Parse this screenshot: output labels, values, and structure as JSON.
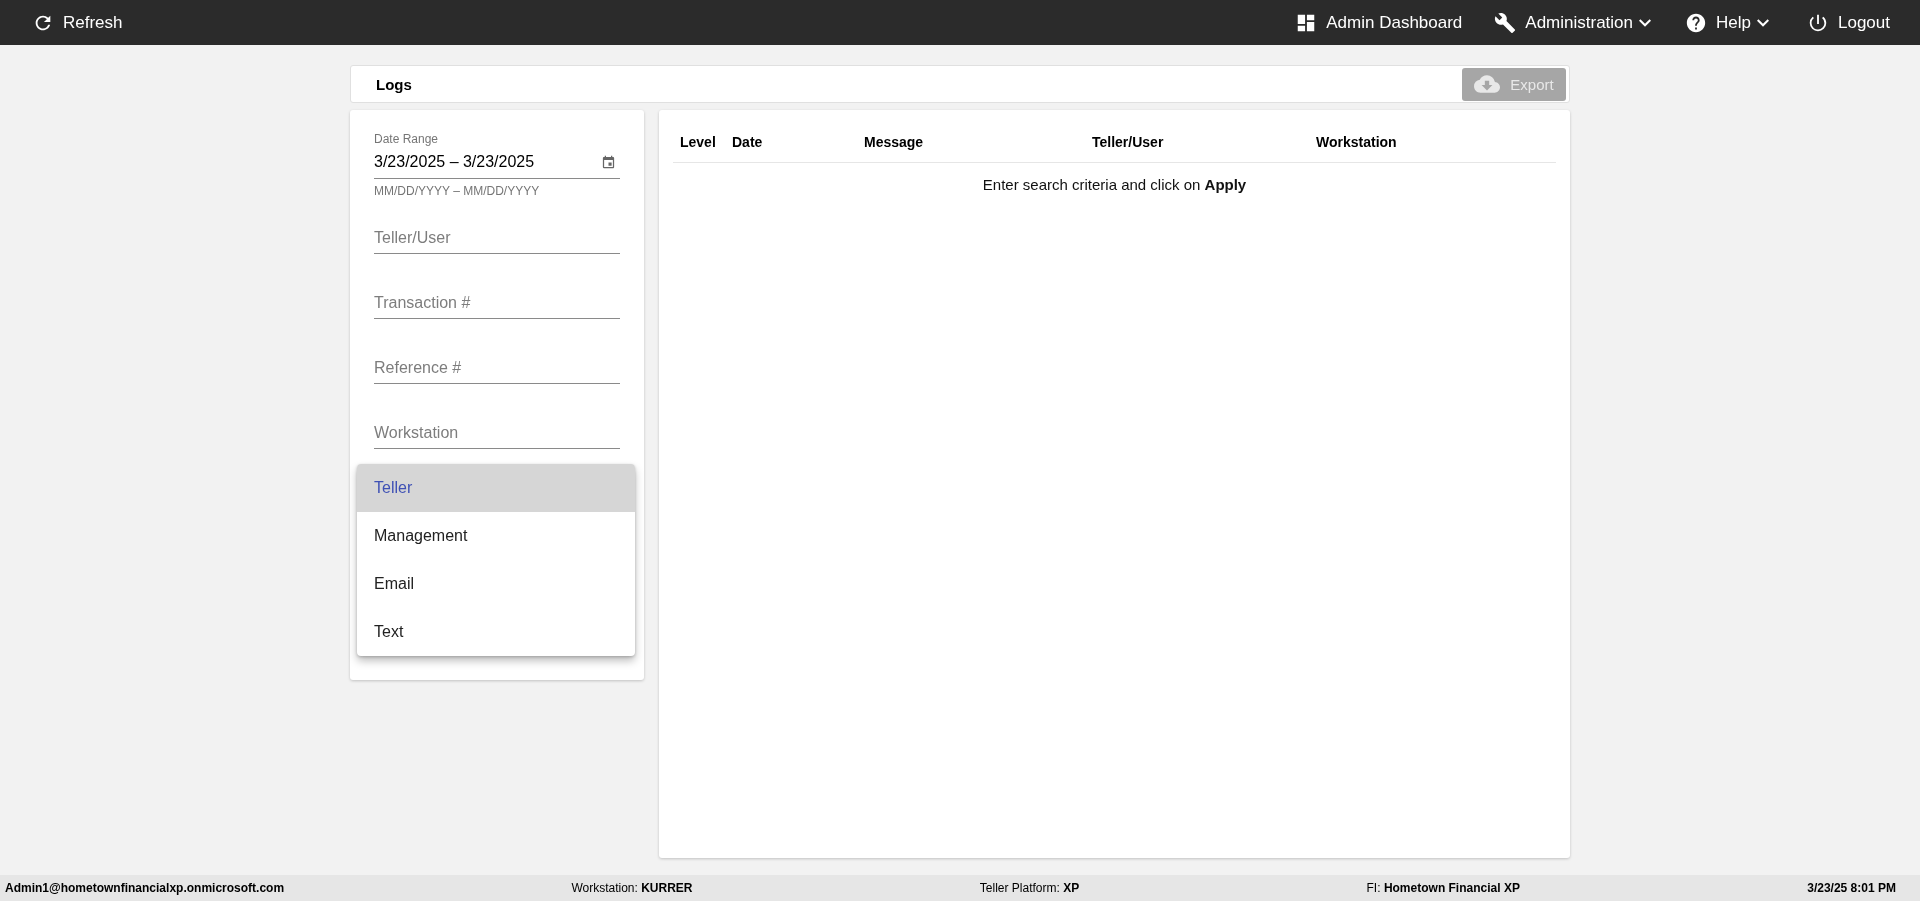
{
  "top_bar": {
    "refresh": "Refresh",
    "links": [
      {
        "label": "Admin Dashboard",
        "kind": "link"
      },
      {
        "label": "Administration",
        "kind": "menu"
      },
      {
        "label": "Help",
        "kind": "menu"
      },
      {
        "label": "Logout",
        "kind": "link"
      }
    ]
  },
  "header": {
    "title": "Logs",
    "export": {
      "label": "Export",
      "disabled": true
    }
  },
  "filters": {
    "date_range": {
      "label": "Date Range",
      "value": "3/23/2025 – 3/23/2025",
      "helper": "MM/DD/YYYY – MM/DD/YYYY"
    },
    "text_fields": [
      {
        "placeholder": "Teller/User"
      },
      {
        "placeholder": "Transaction #"
      },
      {
        "placeholder": "Reference #"
      },
      {
        "placeholder": "Workstation"
      }
    ],
    "category_menu": {
      "options": [
        {
          "label": "Teller",
          "selected": true
        },
        {
          "label": "Management",
          "selected": false
        },
        {
          "label": "Email",
          "selected": false
        },
        {
          "label": "Text",
          "selected": false
        }
      ]
    }
  },
  "table": {
    "columns": [
      "Level",
      "Date",
      "Message",
      "Teller/User",
      "Workstation"
    ],
    "empty_message": "Enter search criteria and click on **Apply**"
  },
  "status_bar": [
    {
      "value": "Admin1@hometownfinancialxp.onmicrosoft.com"
    },
    {
      "label": "Workstation:",
      "value": "KURRER"
    },
    {
      "label": "Teller Platform:",
      "value": "XP"
    },
    {
      "label": "FI:",
      "value": "Hometown Financial XP"
    },
    {
      "value": "3/23/25 8:01 PM"
    }
  ]
}
